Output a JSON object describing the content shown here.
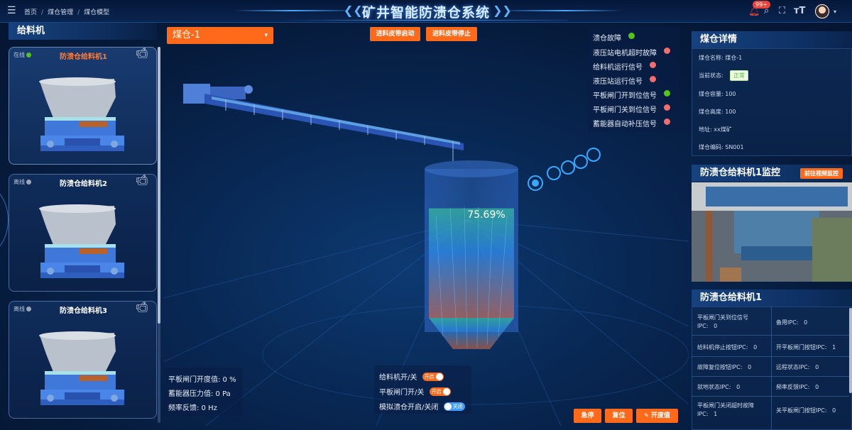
{
  "header": {
    "breadcrumb": [
      "首页",
      "煤仓管理",
      "煤仓模型"
    ],
    "title": "矿井智能防溃仓系统",
    "notification_count": "99+"
  },
  "left_panel": {
    "title": "给料机",
    "cards": [
      {
        "status": "在线",
        "status_color": "#52c41a",
        "name": "防溃仓给料机1",
        "active": true
      },
      {
        "status": "离线",
        "status_color": "#9aa6b8",
        "name": "防溃仓给料机2",
        "active": false
      },
      {
        "status": "离线",
        "status_color": "#9aa6b8",
        "name": "防溃仓给料机3",
        "active": false
      }
    ]
  },
  "center": {
    "bin_select": {
      "value": "煤仓-1"
    },
    "buttons": {
      "start_belt": "进料皮带启动",
      "stop_belt": "进料皮带停止"
    },
    "fill_percent": "75.69%",
    "fill_level": 0.7569,
    "signals": [
      {
        "label": "溃仓故障",
        "state": "green"
      },
      {
        "label": "液压站电机超时故障",
        "state": "red"
      },
      {
        "label": "给料机运行信号",
        "state": "red"
      },
      {
        "label": "液压站运行信号",
        "state": "red"
      },
      {
        "label": "平板闸门开到位信号",
        "state": "green"
      },
      {
        "label": "平板闸门关到位信号",
        "state": "red"
      },
      {
        "label": "蓄能器自动补压信号",
        "state": "red"
      }
    ],
    "readouts": {
      "gate_opening": "平板闸门开度值: 0 %",
      "accumulator_pressure": "蓄能器压力值: 0 Pa",
      "frequency_feedback": "频率反馈: 0 Hz"
    },
    "switches": [
      {
        "label": "给料机开/关",
        "state": "开启"
      },
      {
        "label": "平板闸门开/关",
        "state": "开启"
      },
      {
        "label": "模拟溃仓开启/关闭",
        "state": "关闭"
      }
    ],
    "action_buttons": {
      "emergency_stop": "急停",
      "reset": "复位",
      "opening_value": "开度值"
    }
  },
  "right_panel": {
    "details_title": "煤仓详情",
    "details": {
      "name": "煤仓名称: 煤仓-1",
      "status_label": "当前状态:",
      "status_value": "正常",
      "capacity": "煤仓容量: 100",
      "height": "煤仓高度: 100",
      "address": "地址: xx煤矿",
      "code": "煤仓编码: SN001"
    },
    "monitor_title": "防溃仓给料机1监控",
    "monitor_button": "前往视频监控",
    "feeder_title": "防溃仓给料机1",
    "ipc": [
      [
        "平板闸门关到位信号IPC:",
        "0",
        "备用IPC:",
        "0"
      ],
      [
        "给料机停止按钮IPC:",
        "0",
        "开平板闸门按钮IPC:",
        "1"
      ],
      [
        "故障复位按钮IPC:",
        "0",
        "远程状态IPC:",
        "0"
      ],
      [
        "就地状态IPC:",
        "0",
        "频率反馈IPC:",
        "0"
      ],
      [
        "平板闸门关闭超时故障IPC:",
        "1",
        "关平板闸门按钮IPC:",
        "0"
      ]
    ]
  }
}
